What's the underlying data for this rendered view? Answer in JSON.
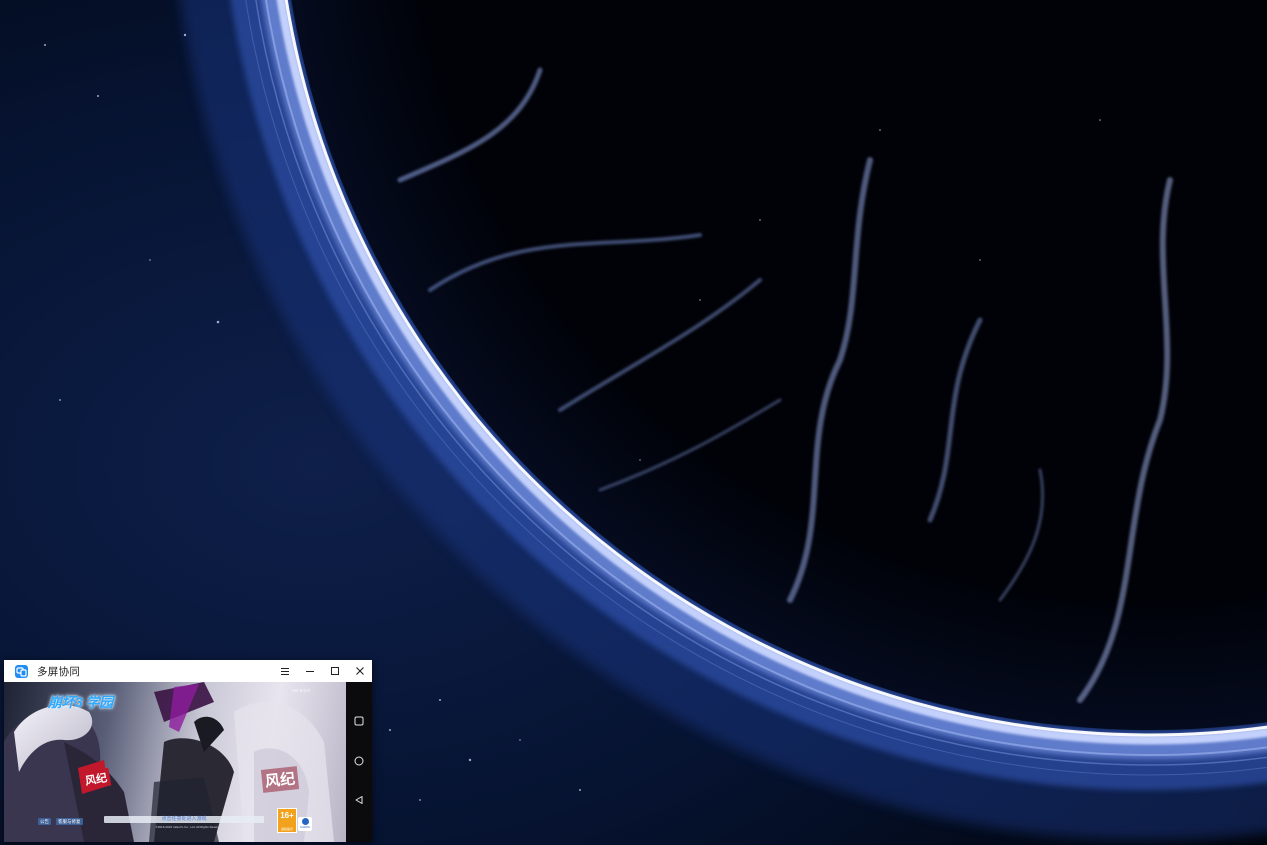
{
  "desktop": {
    "wallpaper_name": "blue-planet-ring-wallpaper",
    "colors": {
      "space": "#02050f",
      "ring_glow": "#dfe8ff",
      "ring_blue": "#3f5fb8",
      "aurora": "#8fa6e8"
    }
  },
  "window": {
    "title": "多屏协同",
    "icon": "multi-screen-collaboration-icon",
    "accent": "#1e8cf0",
    "controls": [
      {
        "name": "menu",
        "glyph": "☰"
      },
      {
        "name": "minimize",
        "glyph": "—"
      },
      {
        "name": "maximize",
        "glyph": "□"
      },
      {
        "name": "close",
        "glyph": "✕"
      }
    ]
  },
  "phone": {
    "game": {
      "logo": "崩坏3 学园",
      "logo_sub": "",
      "version": "Ver.6.0.0",
      "armband_left": "风纪",
      "armband_right": "风纪",
      "tap_prompt": "点击任意处进入游戏",
      "notice_button": "公告",
      "repair_button": "客服与修复",
      "age_rating": "16+",
      "age_caption": "适龄提示",
      "cadpa_label": "CADPA",
      "copyright": "©2016-2024 miHoYo Co., Ltd. All Rights Reserved"
    },
    "nav_buttons": [
      {
        "name": "recents",
        "icon": "square-icon"
      },
      {
        "name": "home",
        "icon": "circle-icon"
      },
      {
        "name": "back",
        "icon": "triangle-back-icon"
      }
    ]
  }
}
